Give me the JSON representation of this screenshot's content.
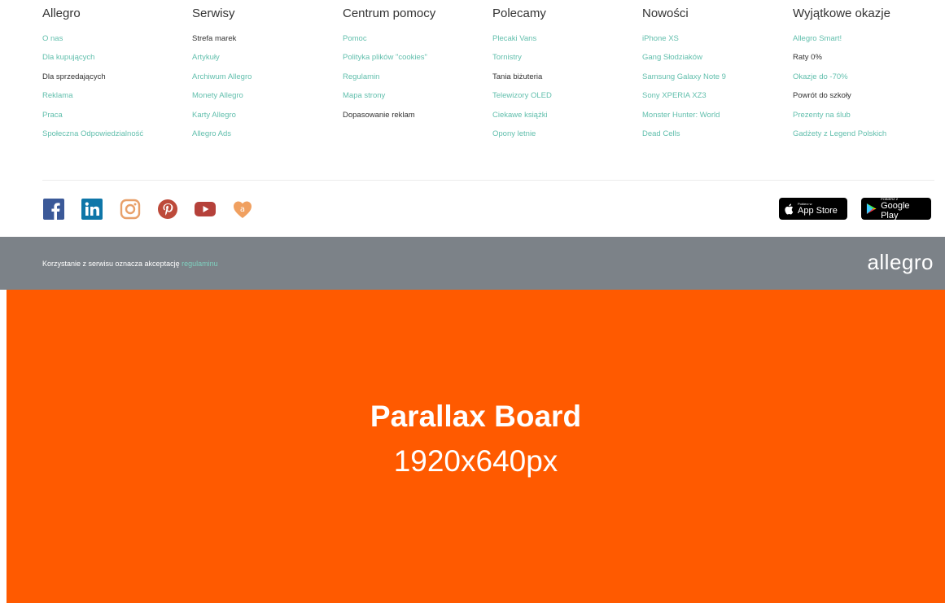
{
  "footer": {
    "columns": [
      {
        "title": "Allegro",
        "links": [
          {
            "label": "O nas",
            "dark": false
          },
          {
            "label": "Dla kupujących",
            "dark": false
          },
          {
            "label": "Dla sprzedających",
            "dark": true
          },
          {
            "label": "Reklama",
            "dark": false
          },
          {
            "label": "Praca",
            "dark": false
          },
          {
            "label": "Społeczna Odpowiedzialność",
            "dark": false
          }
        ]
      },
      {
        "title": "Serwisy",
        "links": [
          {
            "label": "Strefa marek",
            "dark": true
          },
          {
            "label": "Artykuły",
            "dark": false
          },
          {
            "label": "Archiwum Allegro",
            "dark": false
          },
          {
            "label": "Monety Allegro",
            "dark": false
          },
          {
            "label": "Karty Allegro",
            "dark": false
          },
          {
            "label": "Allegro Ads",
            "dark": false
          }
        ]
      },
      {
        "title": "Centrum pomocy",
        "links": [
          {
            "label": "Pomoc",
            "dark": false
          },
          {
            "label": "Polityka plików \"cookies\"",
            "dark": false
          },
          {
            "label": "Regulamin",
            "dark": false
          },
          {
            "label": "Mapa strony",
            "dark": false
          },
          {
            "label": "Dopasowanie reklam",
            "dark": true
          }
        ]
      },
      {
        "title": "Polecamy",
        "links": [
          {
            "label": "Plecaki Vans",
            "dark": false
          },
          {
            "label": "Tornistry",
            "dark": false
          },
          {
            "label": "Tania biżuteria",
            "dark": true
          },
          {
            "label": "Telewizory OLED",
            "dark": false
          },
          {
            "label": "Ciekawe książki",
            "dark": false
          },
          {
            "label": "Opony letnie",
            "dark": false
          }
        ]
      },
      {
        "title": "Nowości",
        "links": [
          {
            "label": "iPhone XS",
            "dark": false
          },
          {
            "label": "Gang Słodziaków",
            "dark": false
          },
          {
            "label": "Samsung Galaxy Note 9",
            "dark": false
          },
          {
            "label": "Sony XPERIA XZ3",
            "dark": false
          },
          {
            "label": "Monster Hunter: World",
            "dark": false
          },
          {
            "label": "Dead Cells",
            "dark": false
          }
        ]
      },
      {
        "title": "Wyjątkowe okazje",
        "links": [
          {
            "label": "Allegro Smart!",
            "dark": false
          },
          {
            "label": "Raty 0%",
            "dark": true
          },
          {
            "label": "Okazje do -70%",
            "dark": false
          },
          {
            "label": "Powrót do szkoły",
            "dark": true
          },
          {
            "label": "Prezenty na ślub",
            "dark": false
          },
          {
            "label": "Gadżety z Legend Polskich",
            "dark": false
          }
        ]
      }
    ]
  },
  "social": {
    "icons": [
      {
        "name": "facebook-icon",
        "color": "#3b5998"
      },
      {
        "name": "linkedin-icon",
        "color": "#0e76a8"
      },
      {
        "name": "instagram-icon",
        "color": "#e8a06a"
      },
      {
        "name": "pinterest-icon",
        "color": "#bd4a3a"
      },
      {
        "name": "youtube-icon",
        "color": "#b5413a"
      },
      {
        "name": "allegro-heart-icon",
        "color": "#f0a060"
      }
    ]
  },
  "stores": {
    "appstore": {
      "small": "Pobierz w",
      "big": "App Store"
    },
    "googleplay": {
      "small": "POBIERZ Z",
      "big": "Google Play"
    }
  },
  "legal": {
    "text": "Korzystanie z serwisu oznacza akceptację ",
    "link": "regulaminu",
    "logo": "allegro"
  },
  "parallax": {
    "title": "Parallax Board",
    "subtitle": "1920x640px",
    "background": "#ff5a00"
  },
  "colors": {
    "link": "#62bfad",
    "legal_bar": "#7c8288"
  }
}
